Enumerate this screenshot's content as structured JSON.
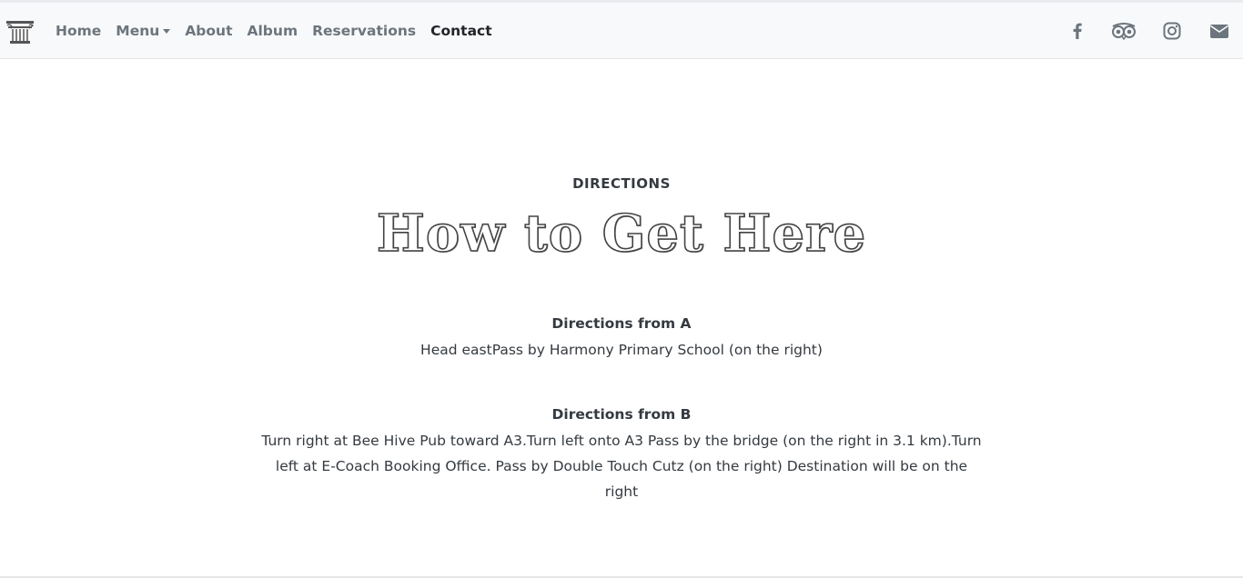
{
  "nav": {
    "items": [
      {
        "label": "Home"
      },
      {
        "label": "Menu"
      },
      {
        "label": "About"
      },
      {
        "label": "Album"
      },
      {
        "label": "Reservations"
      },
      {
        "label": "Contact"
      }
    ],
    "active": "Contact",
    "social_icons": [
      "facebook-icon",
      "tripadvisor-icon",
      "instagram-icon",
      "envelope-icon"
    ]
  },
  "section": {
    "eyebrow": "DIRECTIONS",
    "heading": "How to Get Here"
  },
  "directions": [
    {
      "title": "Directions from A",
      "text": "Head eastPass by Harmony Primary School (on the right)"
    },
    {
      "title": "Directions from B",
      "text": "Turn right at Bee Hive Pub toward A3.Turn left onto A3 Pass by the bridge (on the right in 3.1 km).Turn left at E-Coach Booking Office. Pass by Double Touch Cutz (on the right) Destination will be on the right"
    }
  ],
  "colors": {
    "navbar_bg": "#f8f9fa",
    "nav_link": "#6c757d",
    "nav_active": "#212529",
    "text": "#343a40"
  }
}
